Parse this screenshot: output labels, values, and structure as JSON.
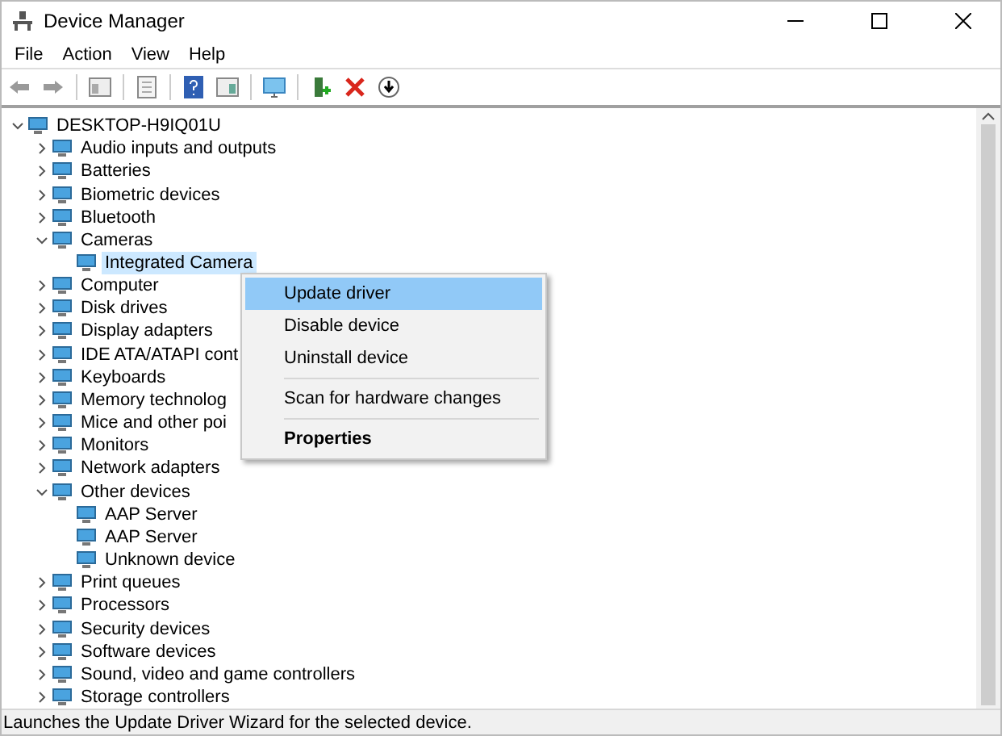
{
  "window": {
    "title": "Device Manager"
  },
  "menu_bar": [
    "File",
    "Action",
    "View",
    "Help"
  ],
  "tree": {
    "label": "DESKTOP-H9IQ01U",
    "expanded": true,
    "selected": false,
    "children": [
      {
        "label": "Audio inputs and outputs",
        "expanded": false,
        "selected": false
      },
      {
        "label": "Batteries",
        "expanded": false,
        "selected": false
      },
      {
        "label": "Biometric devices",
        "expanded": false,
        "selected": false
      },
      {
        "label": "Bluetooth",
        "expanded": false,
        "selected": false
      },
      {
        "label": "Cameras",
        "expanded": true,
        "selected": false,
        "children": [
          {
            "label": "Integrated Camera",
            "selected": true
          }
        ]
      },
      {
        "label": "Computer",
        "expanded": false,
        "selected": false
      },
      {
        "label": "Disk drives",
        "expanded": false,
        "selected": false
      },
      {
        "label": "Display adapters",
        "expanded": false,
        "selected": false
      },
      {
        "label": "IDE ATA/ATAPI cont",
        "expanded": false,
        "selected": false
      },
      {
        "label": "Keyboards",
        "expanded": false,
        "selected": false
      },
      {
        "label": "Memory technolog",
        "expanded": false,
        "selected": false
      },
      {
        "label": "Mice and other poi",
        "expanded": false,
        "selected": false
      },
      {
        "label": "Monitors",
        "expanded": false,
        "selected": false
      },
      {
        "label": "Network adapters",
        "expanded": false,
        "selected": false
      },
      {
        "label": "Other devices",
        "expanded": true,
        "selected": false,
        "children": [
          {
            "label": "AAP Server",
            "selected": false
          },
          {
            "label": "AAP Server",
            "selected": false
          },
          {
            "label": "Unknown device",
            "selected": false
          }
        ]
      },
      {
        "label": "Print queues",
        "expanded": false,
        "selected": false
      },
      {
        "label": "Processors",
        "expanded": false,
        "selected": false
      },
      {
        "label": "Security devices",
        "expanded": false,
        "selected": false
      },
      {
        "label": "Software devices",
        "expanded": false,
        "selected": false
      },
      {
        "label": "Sound, video and game controllers",
        "expanded": false,
        "selected": false
      },
      {
        "label": "Storage controllers",
        "expanded": false,
        "selected": false
      }
    ]
  },
  "context_menu": {
    "groups": [
      [
        {
          "label": "Update driver",
          "selected": true,
          "default": false
        },
        {
          "label": "Disable device",
          "selected": false,
          "default": false
        },
        {
          "label": "Uninstall device",
          "selected": false,
          "default": false
        }
      ],
      [
        {
          "label": "Scan for hardware changes",
          "selected": false,
          "default": false
        }
      ],
      [
        {
          "label": "Properties",
          "selected": false,
          "default": true
        }
      ]
    ]
  },
  "status_bar": "Launches the Update Driver Wizard for the selected device."
}
